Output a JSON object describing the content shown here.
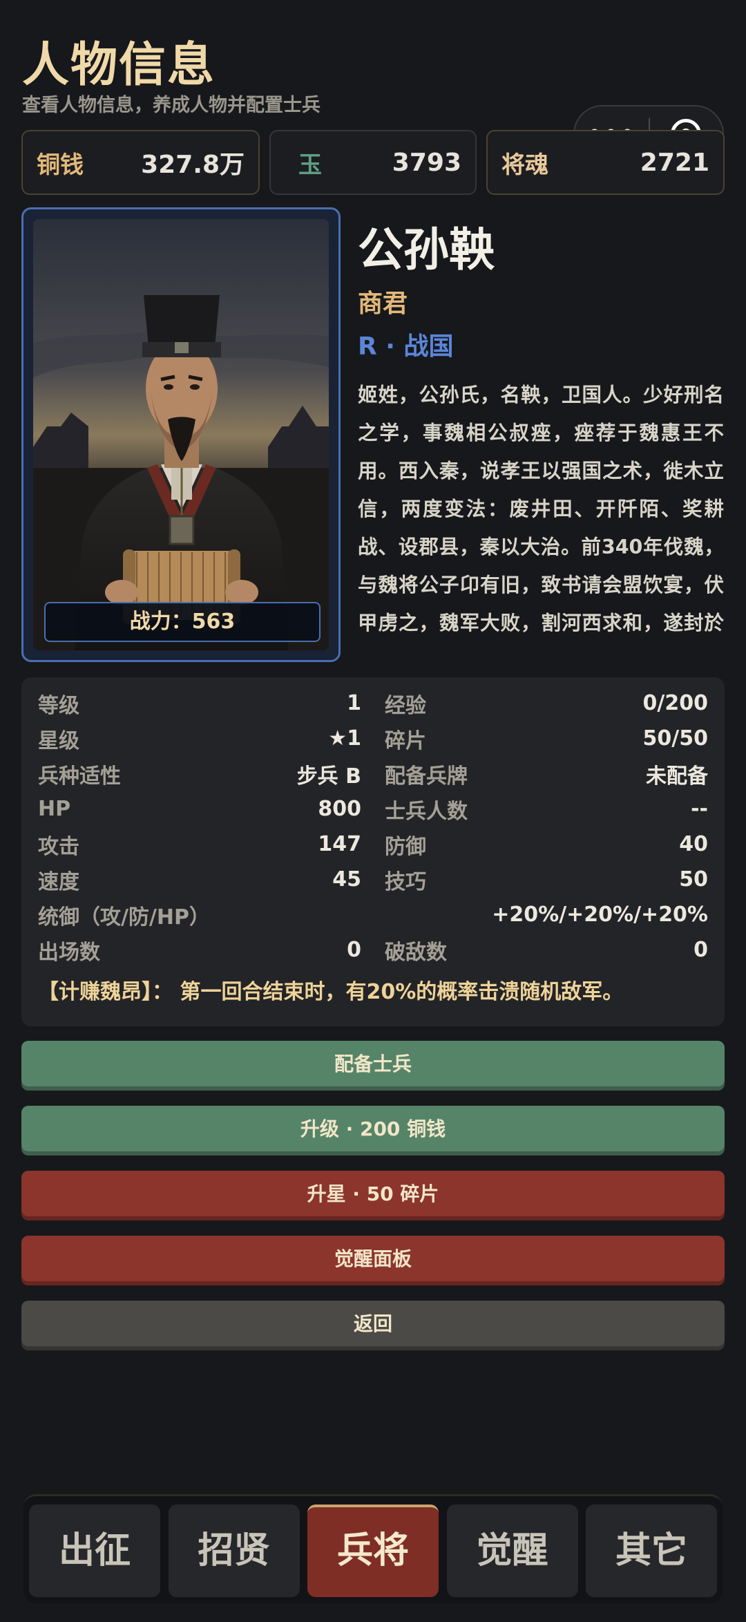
{
  "header": {
    "title": "人物信息",
    "subtitle": "查看人物信息，养成人物并配置士兵"
  },
  "capsule": {
    "more": "•••"
  },
  "currencies": [
    {
      "name": "铜钱",
      "value": "327.8万",
      "color": "#e3b979"
    },
    {
      "name": "玉",
      "value": "3793",
      "color": "#5f9e82"
    },
    {
      "name": "将魂",
      "value": "2721",
      "color": "#e8c99a"
    }
  ],
  "hero": {
    "name": "公孙鞅",
    "title": "商君",
    "rarity": "R · 战国",
    "power": "战力：563",
    "bio": "姬姓，公孙氏，名鞅，卫国人。少好刑名之学，事魏相公叔痤，痤荐于魏惠王不用。西入秦，说孝王以强国之术，徙木立信，两度变法：废井田、开阡陌、奖耕战、设郡县，秦以大治。前340年伐魏，与魏将公子卬有旧，致书请会盟饮宴，伏甲虏之，魏军大败，割河西求和，遂封於商，"
  },
  "stats": {
    "rows": [
      {
        "l_label": "等级",
        "l_value": "1",
        "r_label": "经验",
        "r_value": "0/200"
      },
      {
        "l_label": "星级",
        "l_value": "★1",
        "r_label": "碎片",
        "r_value": "50/50"
      },
      {
        "l_label": "兵种适性",
        "l_value": "步兵 B",
        "r_label": "配备兵牌",
        "r_value": "未配备"
      },
      {
        "l_label": "HP",
        "l_value": "800",
        "r_label": "士兵人数",
        "r_value": "--"
      },
      {
        "l_label": "攻击",
        "l_value": "147",
        "r_label": "防御",
        "r_value": "40"
      },
      {
        "l_label": "速度",
        "l_value": "45",
        "r_label": "技巧",
        "r_value": "50"
      }
    ],
    "command_label": "统御（攻/防/HP）",
    "command_value": "+20%/+20%/+20%",
    "battles_label": "出场数",
    "battles_value": "0",
    "kills_label": "破敌数",
    "kills_value": "0",
    "skill": "【计赚魏昂】： 第一回合结束时，有20%的概率击溃随机敌军。"
  },
  "actions": {
    "equip_soldiers": "配备士兵",
    "level_up": "升级 · 200 铜钱",
    "star_up": "升星 · 50 碎片",
    "awaken_panel": "觉醒面板",
    "back": "返回"
  },
  "nav": {
    "tabs": [
      "出征",
      "招贤",
      "兵将",
      "觉醒",
      "其它"
    ],
    "active": "兵将"
  }
}
